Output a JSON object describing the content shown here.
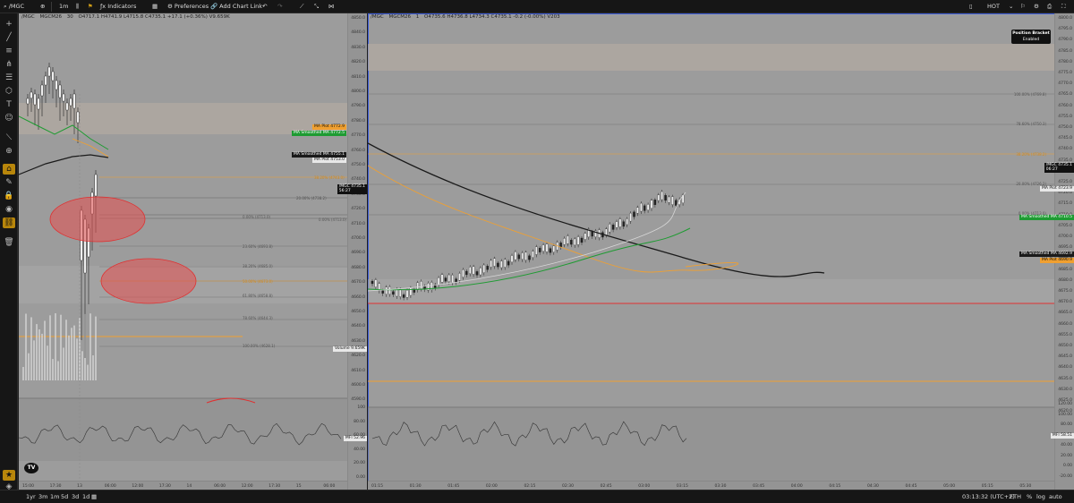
{
  "topbar": {
    "symbol": "/MGC",
    "interval": "1m",
    "indicators_label": "Indicators",
    "preferences_label": "Preferences",
    "add_chart_link_label": "Add Chart Link",
    "account": "HOT"
  },
  "tooltip": {
    "title": "Position Bracket",
    "state": "Enabled"
  },
  "left_pane": {
    "legend_symbol": "/MGC",
    "legend_contract": "MGCM26",
    "legend_interval": "30",
    "ohlc": "O4717.1 H4741.9 L4715.8 C4735.1 +17.1 (+0.36%) V9.659K",
    "price_labels": [
      "4850.0",
      "4840.0",
      "4830.0",
      "4820.0",
      "4810.0",
      "4800.0",
      "4790.0",
      "4780.0",
      "4770.0",
      "4760.0",
      "4750.0",
      "4740.0",
      "4730.0",
      "4720.0",
      "4710.0",
      "4700.0",
      "4690.0",
      "4680.0",
      "4670.0",
      "4660.0",
      "4650.0",
      "4640.0",
      "4630.0",
      "4620.0",
      "4610.0",
      "4600.0",
      "4590.0"
    ],
    "mfi_labels": [
      "100",
      "80.00",
      "60.00",
      "40.00",
      "20.00",
      "0.00"
    ],
    "time_labels": [
      "15:00",
      "17:30",
      "13",
      "06:00",
      "12:00",
      "17:30",
      "14",
      "06:00",
      "12:00",
      "17:30",
      "15",
      "06:00"
    ],
    "tags": {
      "ma_plot_1": {
        "label": "MA Plot",
        "value": "4772.9"
      },
      "ma_smoothed_1": {
        "label": "MA Smoothed MA",
        "value": "4772.5"
      },
      "ma_smoothed_2": {
        "label": "MA Smoothed MA",
        "value": "4755.1"
      },
      "ma_plot_2": {
        "label": "MA Plot",
        "value": "4753.0"
      },
      "price": {
        "label": "/MGC",
        "value": "4735.1",
        "timer": "56:27"
      },
      "volume": {
        "label": "Volume",
        "value": "9.659K"
      },
      "mfi": {
        "label": "MFI",
        "value": "52.96"
      }
    },
    "fib_labels": [
      "0.00% (4713.0)",
      "23.60% (4693.8)",
      "38.20% (4685.0)",
      "50.00% (4673.0)",
      "61.80% (4658.8)",
      "78.60% (4644.3)",
      "100.00% (4628.1)",
      "20.00% (4738.2)",
      "0.00% (4713.0)",
      "38.20% (4743.0)"
    ]
  },
  "right_pane": {
    "legend_symbol": "/MGC",
    "legend_contract": "MGCM26",
    "legend_interval": "1",
    "ohlc": "O4735.6 H4736.8 L4734.3 C4735.1 -0.2 (-0.00%) V203",
    "price_labels": [
      "4800.0",
      "4795.0",
      "4790.0",
      "4785.0",
      "4780.0",
      "4775.0",
      "4770.0",
      "4765.0",
      "4760.0",
      "4755.0",
      "4750.0",
      "4745.0",
      "4740.0",
      "4735.0",
      "4730.0",
      "4725.0",
      "4720.0",
      "4715.0",
      "4710.0",
      "4705.0",
      "4700.0",
      "4695.0",
      "4690.0",
      "4685.0",
      "4680.0",
      "4675.0",
      "4670.0",
      "4665.0",
      "4660.0",
      "4655.0",
      "4650.0",
      "4645.0",
      "4640.0",
      "4635.0",
      "4630.0",
      "4625.0",
      "4620.0"
    ],
    "mfi_labels": [
      "120.00",
      "100.00",
      "80.00",
      "60.00",
      "40.00",
      "20.00",
      "0.00",
      "-20.00"
    ],
    "time_labels": [
      "01:15",
      "01:30",
      "01:45",
      "02:00",
      "02:15",
      "02:30",
      "02:45",
      "03:00",
      "03:15",
      "03:30",
      "03:45",
      "04:00",
      "04:15",
      "04:30",
      "04:45",
      "05:00",
      "05:15",
      "05:30"
    ],
    "tags": {
      "price": {
        "label": "/MGC",
        "value": "4735.1",
        "timer": "06:27"
      },
      "ma_plot_1": {
        "label": "MA Plot",
        "value": "4723.9"
      },
      "ma_smoothed_1": {
        "label": "MA Smoothed MA",
        "value": "4710.5"
      },
      "ma_smoothed_2": {
        "label": "MA Smoothed MA",
        "value": "4692.9"
      },
      "ma_plot_2": {
        "label": "MA Plot",
        "value": "4690.9"
      },
      "mfi": {
        "label": "MFI",
        "value": "58.51"
      }
    },
    "fib_labels": [
      "100.00% (4769.8)",
      "78.60% (4750.3)",
      "38.20% (4738.2)",
      "20.00% (4726.2)",
      "0.00% (4713.0)"
    ]
  },
  "bottombar": {
    "ranges": [
      "1yr",
      "3m",
      "1m",
      "5d",
      "3d",
      "1d"
    ],
    "clock": "03:13:32 (UTC+2)",
    "session": "ETH",
    "percent": "%",
    "log": "log",
    "auto": "auto"
  },
  "colors": {
    "accent": "#b8860b",
    "ma_orange": "#f0a030",
    "ma_green": "#1e9b32",
    "ma_black": "#1a1a1a",
    "fib_red": "#e03030"
  }
}
